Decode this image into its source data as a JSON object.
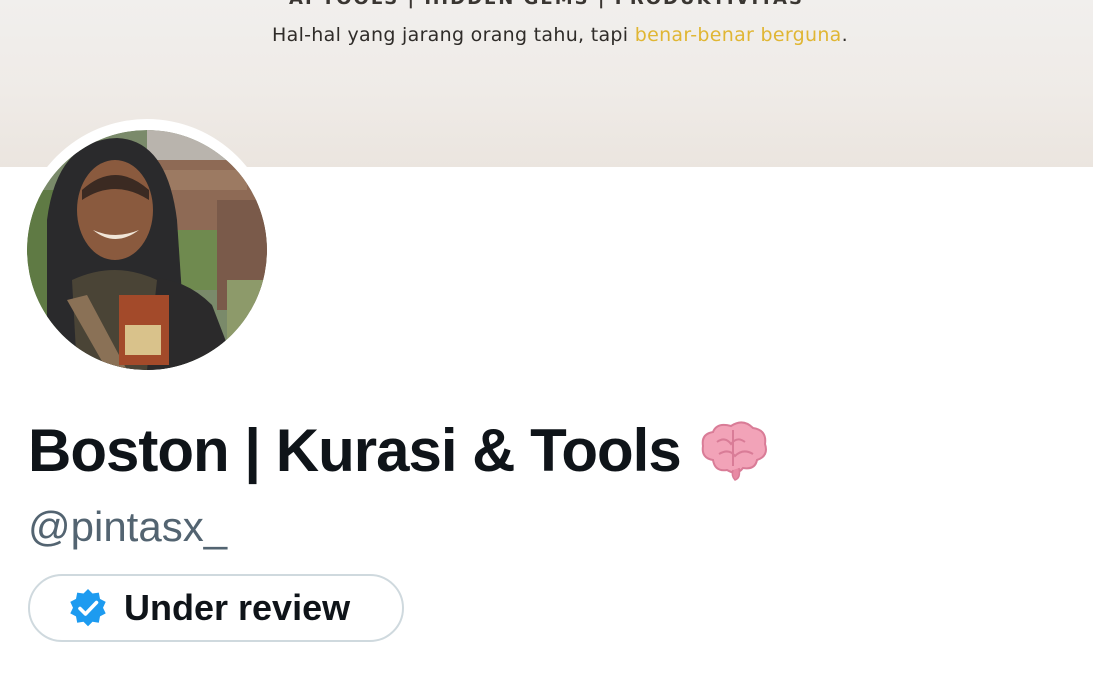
{
  "banner": {
    "top_line": "AI TOOLS | HIDDEN GEMS | PRODUKTIVITAS",
    "tagline_prefix": "Hal-hal yang jarang orang tahu, tapi ",
    "tagline_highlight": "benar-benar berguna",
    "tagline_suffix": ".",
    "highlight_color": "#e0b633"
  },
  "profile": {
    "display_name": "Boston | Kurasi & Tools",
    "name_emoji_icon": "brain-icon",
    "handle": "@pintasx_",
    "status": {
      "icon": "verified-badge-icon",
      "label": "Under review",
      "badge_color": "#1d9bf0"
    }
  }
}
